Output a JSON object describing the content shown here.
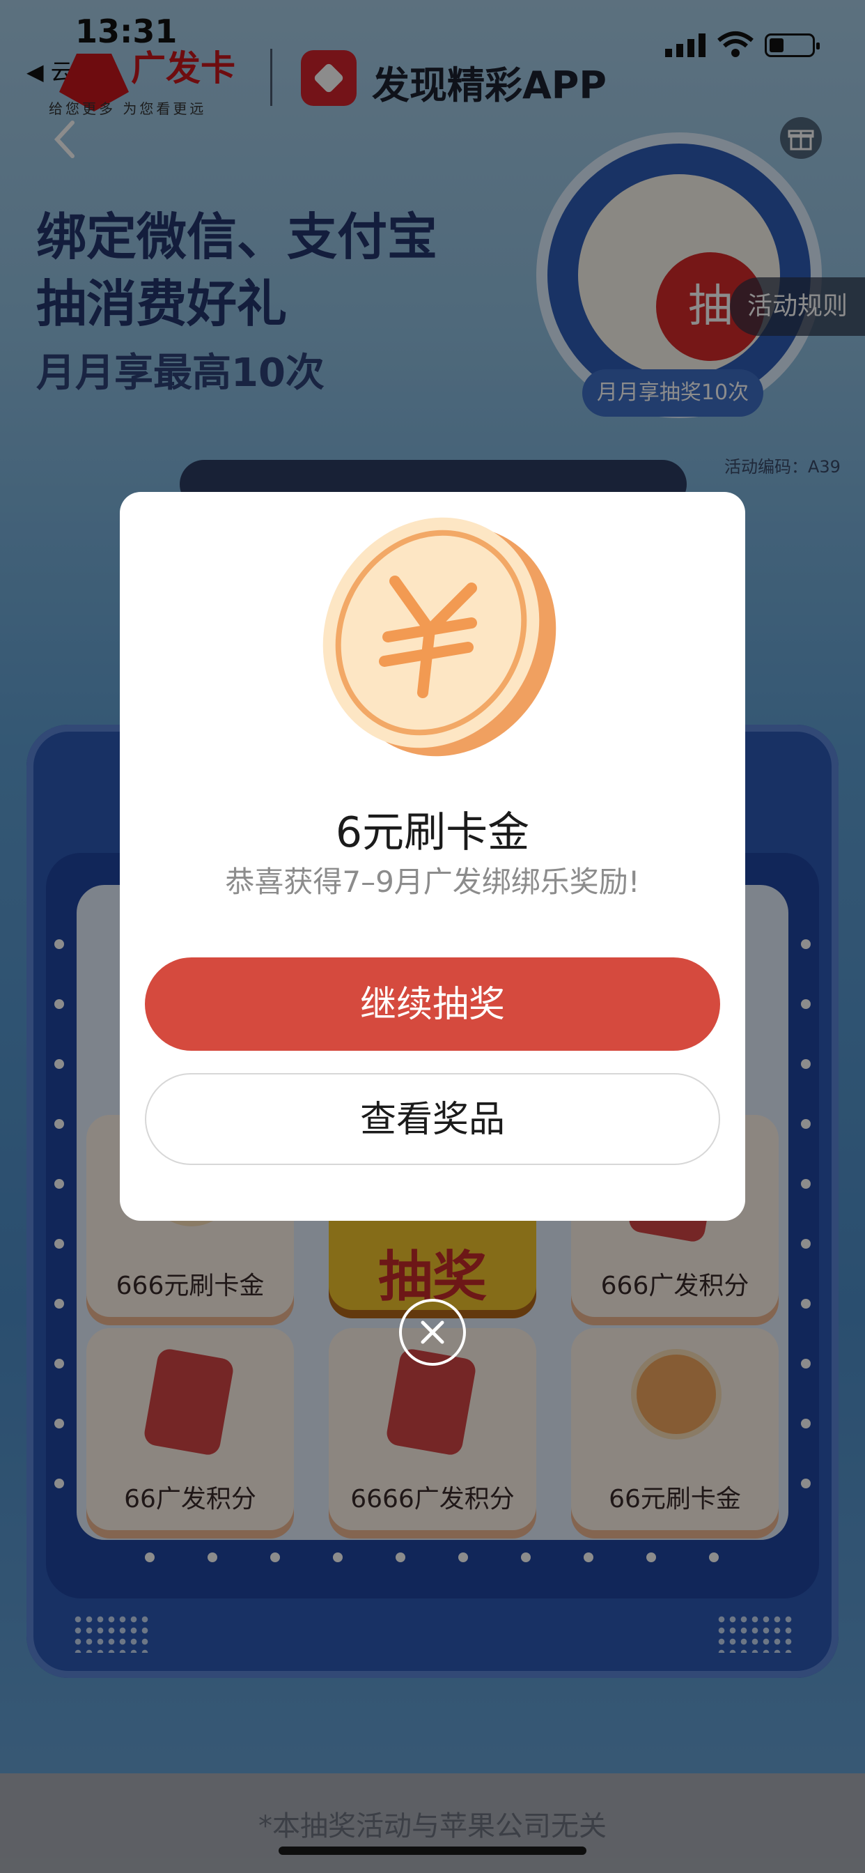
{
  "status_bar": {
    "time": "13:31",
    "back_app": "◀ 云闪付"
  },
  "header": {
    "brand_name": "广发卡",
    "brand_slogan": "给您更多  为您看更远",
    "app_name": "发现精彩APP"
  },
  "banner": {
    "headline_1": "绑定微信、支付宝",
    "headline_2": "抽消费好礼",
    "subline": "月月享最高10次",
    "wheel_center": "抽",
    "wheel_pill": "月月享抽奖10次",
    "activity_code": "活动编码：A39",
    "rules_tab": "活动规则"
  },
  "board": {
    "center_label": "抽奖",
    "tiles": [
      {
        "label": "666元刷卡金"
      },
      {
        "label": "666广发积分"
      },
      {
        "label": "66广发积分"
      },
      {
        "label": "6666广发积分"
      },
      {
        "label": "66元刷卡金"
      }
    ]
  },
  "modal": {
    "prize_title": "6元刷卡金",
    "prize_subtitle": "恭喜获得7–9月广发绑绑乐奖励!",
    "continue_button": "继续抽奖",
    "view_prizes_button": "查看奖品"
  },
  "footer": {
    "disclaimer": "*本抽奖活动与苹果公司无关"
  },
  "colors": {
    "accent_red": "#d54a3e",
    "coin_orange": "#f4a860",
    "board_blue": "#2d59b6"
  }
}
